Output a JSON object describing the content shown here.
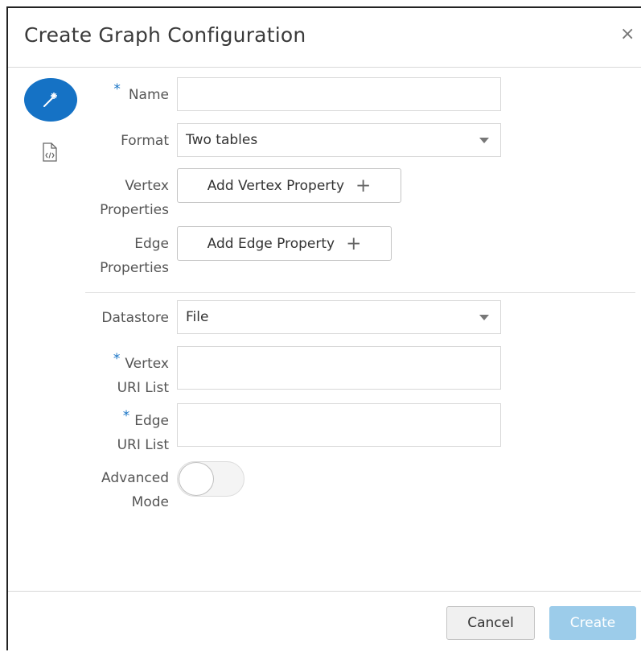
{
  "dialog": {
    "title": "Create Graph Configuration",
    "close_glyph": "×"
  },
  "nav": {
    "steps": [
      {
        "icon": "magic-wand-icon",
        "active": true
      },
      {
        "icon": "code-file-icon",
        "active": false
      }
    ]
  },
  "form": {
    "required_marker": "*",
    "name": {
      "label": "Name",
      "value": ""
    },
    "format": {
      "label": "Format",
      "value": "Two tables"
    },
    "vertex_properties": {
      "label_line1": "Vertex",
      "label_line2": "Properties",
      "button": "Add Vertex Property"
    },
    "edge_properties": {
      "label_line1": "Edge",
      "label_line2": "Properties",
      "button": "Add Edge Property"
    },
    "datastore": {
      "label": "Datastore",
      "value": "File"
    },
    "vertex_uri": {
      "label_line1": "Vertex",
      "label_line2": "URI List",
      "value": ""
    },
    "edge_uri": {
      "label_line1": "Edge",
      "label_line2": "URI List",
      "value": ""
    },
    "advanced_mode": {
      "label_line1": "Advanced",
      "label_line2": "Mode",
      "enabled": false
    }
  },
  "footer": {
    "cancel": "Cancel",
    "create": "Create"
  },
  "colors": {
    "accent": "#1572c5",
    "create_disabled": "#9cccea"
  }
}
